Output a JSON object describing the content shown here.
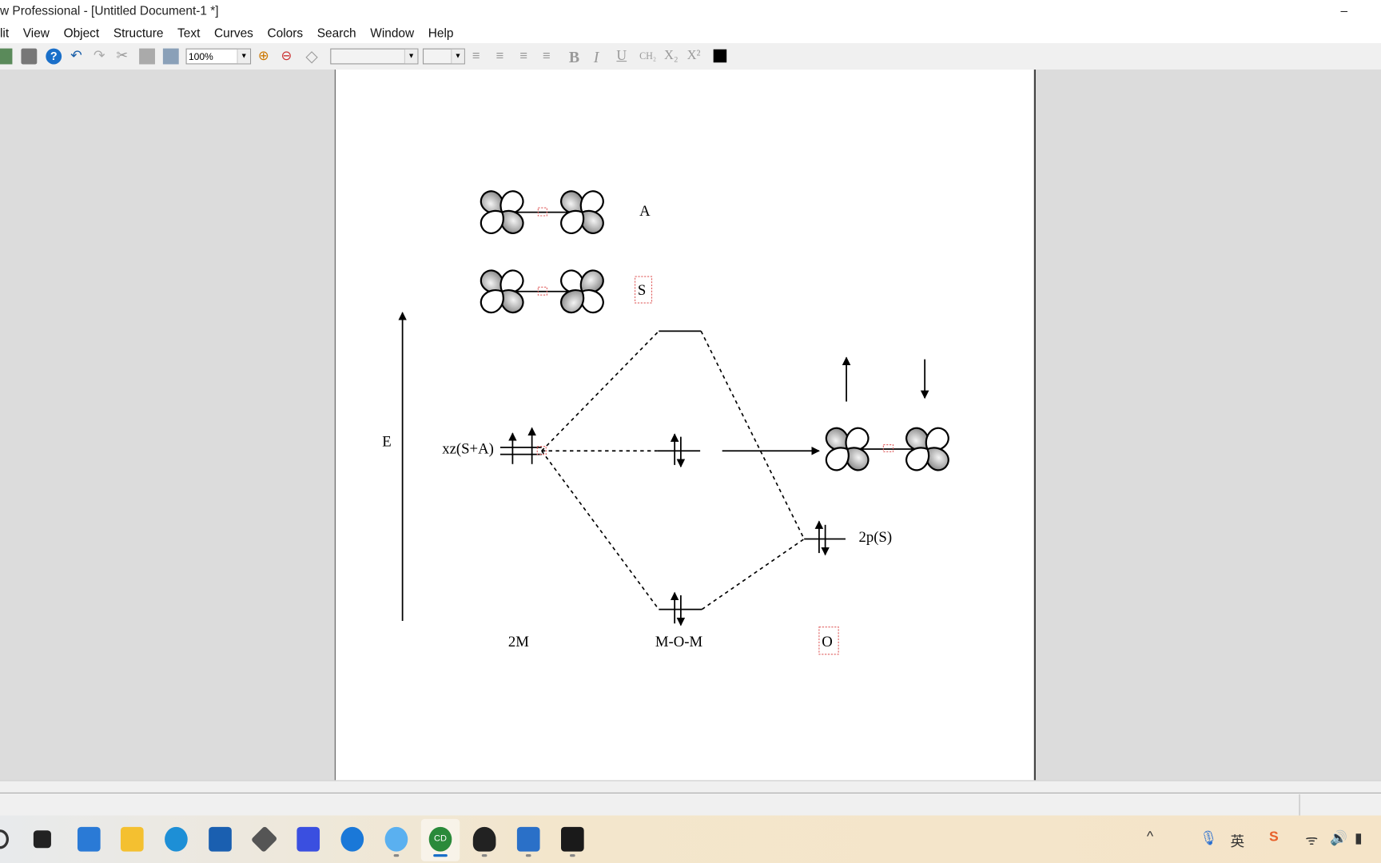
{
  "window": {
    "title": "w Professional - [Untitled Document-1 *]",
    "minimize": "–"
  },
  "menu": [
    "lit",
    "View",
    "Object",
    "Structure",
    "Text",
    "Curves",
    "Colors",
    "Search",
    "Window",
    "Help"
  ],
  "toolbar": {
    "zoom": "100%",
    "font": "",
    "size": "",
    "ch2": "CH₂",
    "sub": "X₂",
    "sup": "X²",
    "bold": "B",
    "italic": "I",
    "underline": "U"
  },
  "diagram": {
    "orbital_labels": {
      "a": "A",
      "s": "S"
    },
    "axis_label": "E",
    "metal_level": "xz(S+A)",
    "oxygen_level": "2p(S)",
    "columns": {
      "left": "2M",
      "middle": "M-O-M",
      "right": "O"
    }
  },
  "taskbar": {
    "apps": [
      "search",
      "task-view",
      "widgets",
      "file-explorer",
      "edge",
      "store",
      "app-3d",
      "app-m",
      "app-arrow",
      "app-browser",
      "chemdraw",
      "qq",
      "photos",
      "recorder"
    ],
    "active": "chemdraw",
    "tray": {
      "chevron": "^",
      "ime": "英",
      "sogou": "S"
    }
  },
  "colors": {
    "selection": "#e06060",
    "workspace": "#dcdcdc"
  }
}
